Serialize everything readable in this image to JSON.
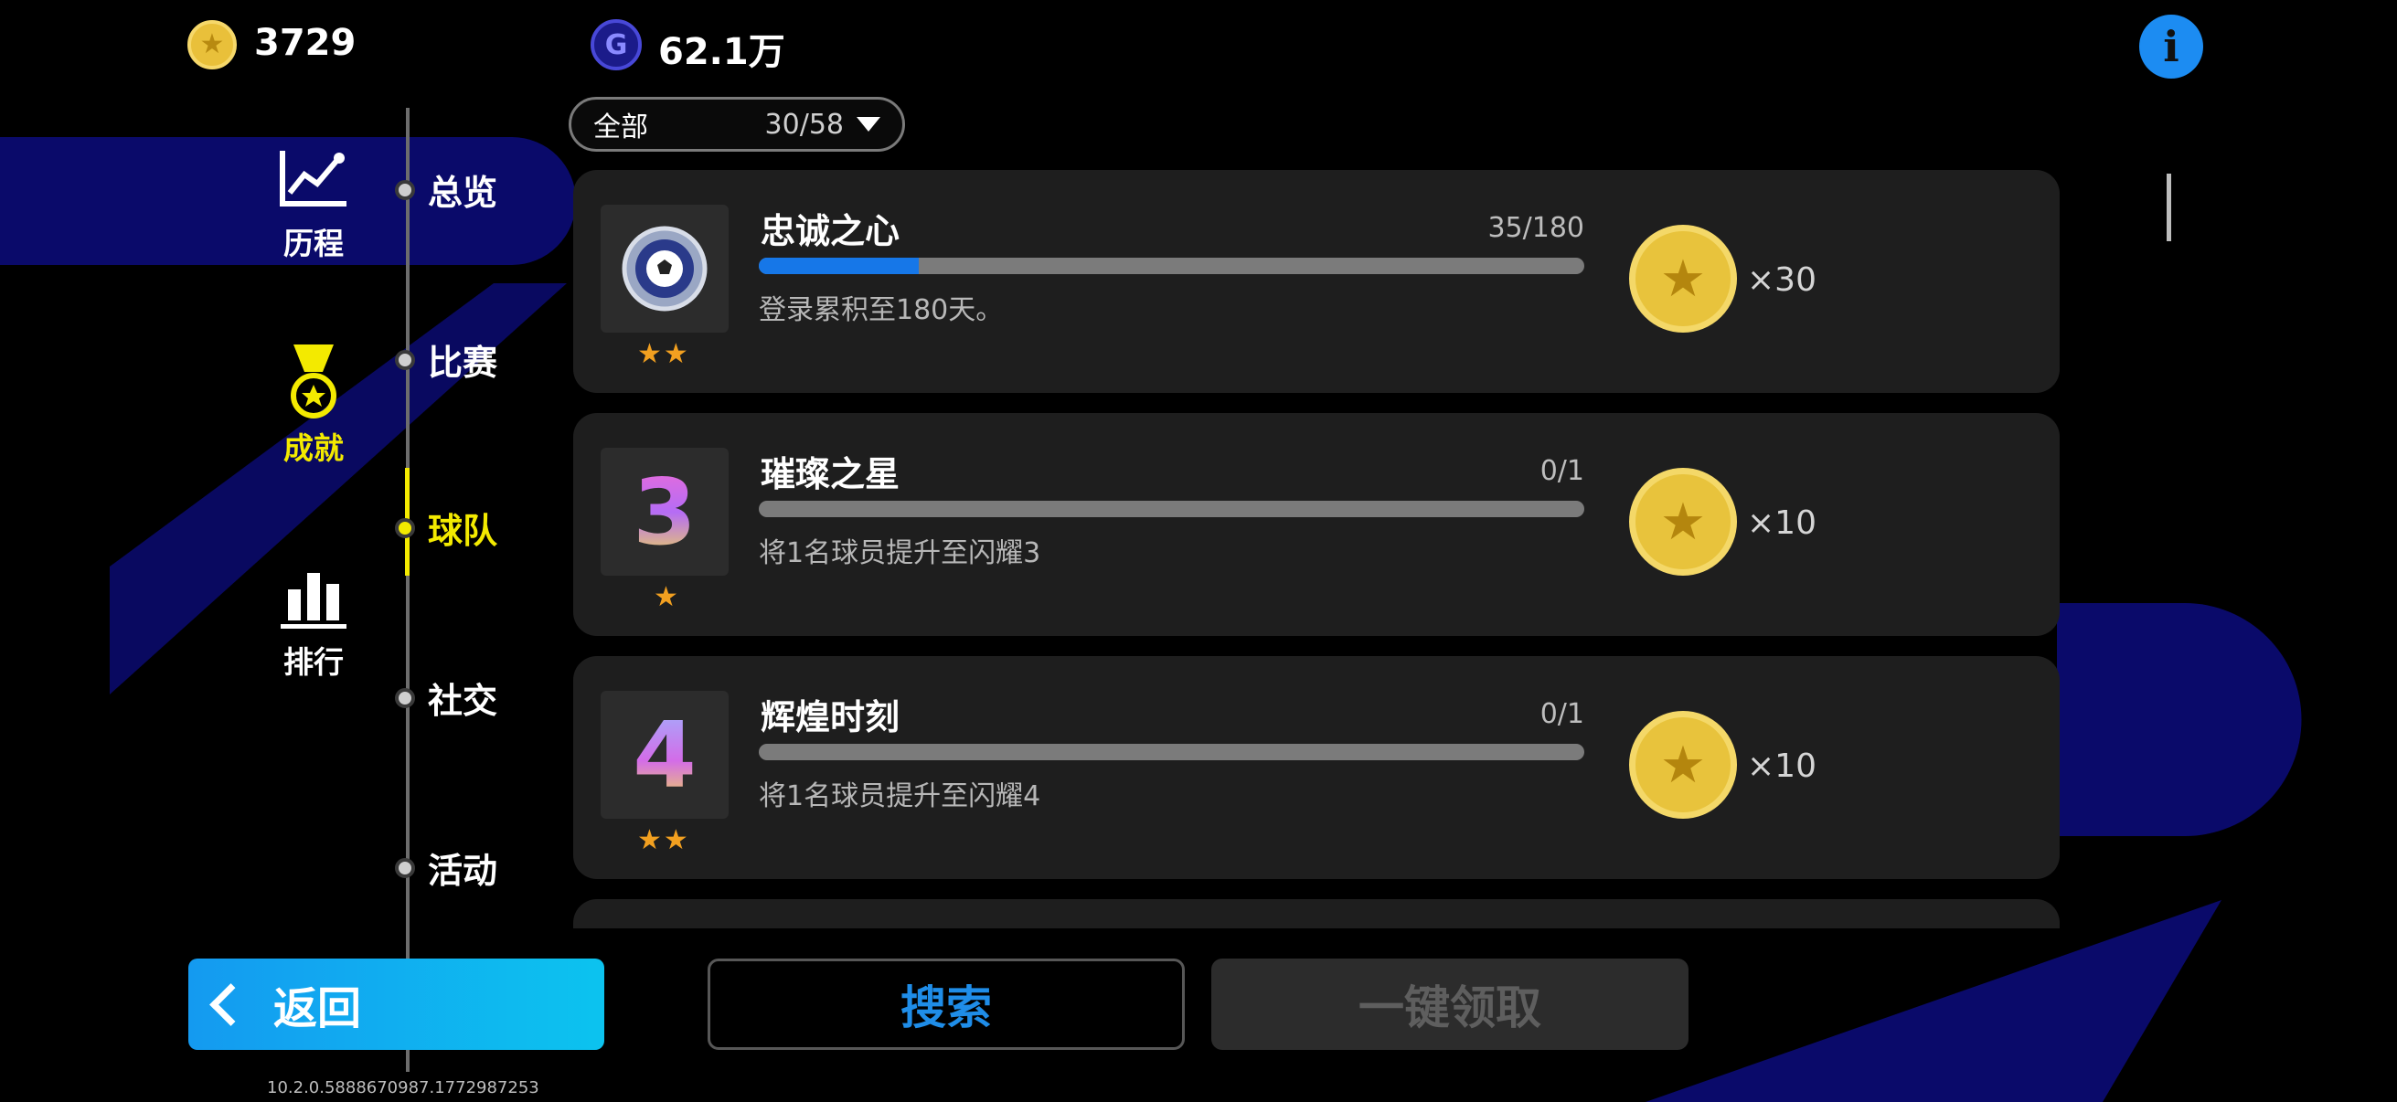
{
  "top": {
    "coins": "3729",
    "gp": "62.1万",
    "gp_icon_letter": "G",
    "info_symbol": "i"
  },
  "nav": [
    {
      "label": "历程",
      "icon": "line-chart-icon",
      "active": false
    },
    {
      "label": "成就",
      "icon": "medal-icon",
      "active": true
    },
    {
      "label": "排行",
      "icon": "bar-chart-icon",
      "active": false
    }
  ],
  "sub_nav": [
    {
      "label": "总览"
    },
    {
      "label": "比赛"
    },
    {
      "label": "球队",
      "active": true
    },
    {
      "label": "社交"
    },
    {
      "label": "活动"
    }
  ],
  "filter": {
    "label": "全部",
    "count": "30/58"
  },
  "achievements": [
    {
      "title": "忠诚之心",
      "progress_text": "35/180",
      "progress_fraction": 0.194,
      "description": "登录累积至180天。",
      "stars": "★★",
      "reward": "×30",
      "icon": "soccer-ball-badge-icon"
    },
    {
      "title": "璀璨之星",
      "progress_text": "0/1",
      "progress_fraction": 0,
      "description": "将1名球员提升至闪耀3",
      "stars": "★",
      "reward": "×10",
      "icon_text": "3",
      "icon": "number-3-icon"
    },
    {
      "title": "辉煌时刻",
      "progress_text": "0/1",
      "progress_fraction": 0,
      "description": "将1名球员提升至闪耀4",
      "stars": "★★",
      "reward": "×10",
      "icon_text": "4",
      "icon": "number-4-icon"
    }
  ],
  "buttons": {
    "back": "返回",
    "search": "搜索",
    "claim_all": "一键领取"
  },
  "version": "10.2.0.5888670987.1772987253",
  "colors": {
    "accent_yellow": "#f3ea00",
    "accent_blue": "#1677e8",
    "background": "#000000"
  }
}
